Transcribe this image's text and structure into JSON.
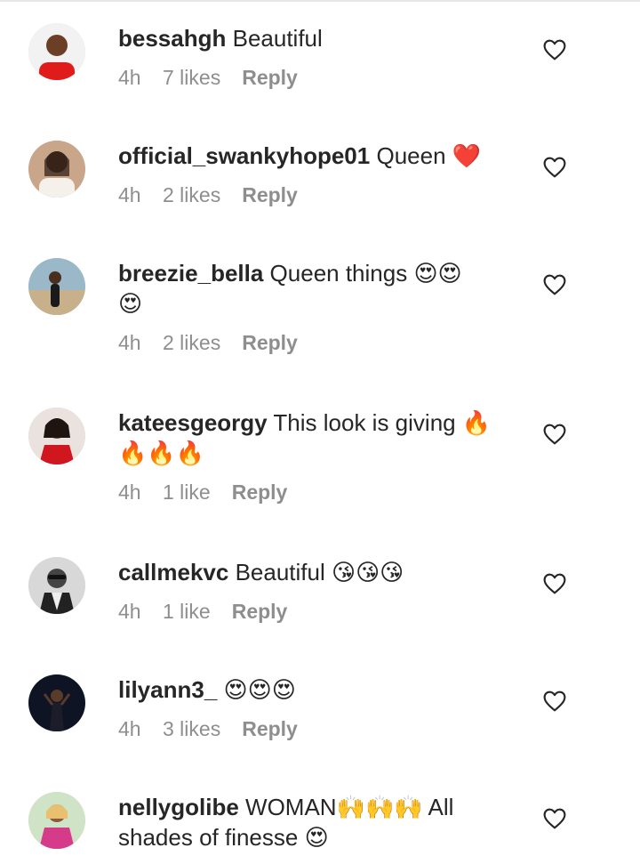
{
  "colors": {
    "text": "#262626",
    "muted": "#8e8e8e",
    "heart_red": "#e0245e"
  },
  "comments": [
    {
      "username": "bessahgh",
      "text": "Beautiful",
      "text_line2": "",
      "time": "4h",
      "likes": "7 likes",
      "reply": "Reply",
      "avatar": "avatar-red-shirt-man"
    },
    {
      "username": "official_swankyhope01",
      "text": "Queen ❤️",
      "text_line2": "",
      "time": "4h",
      "likes": "2 likes",
      "reply": "Reply",
      "avatar": "avatar-woman-white-top"
    },
    {
      "username": "breezie_bella",
      "text": "Queen things 😍😍",
      "text_line2": "😍",
      "time": "4h",
      "likes": "2 likes",
      "reply": "Reply",
      "avatar": "avatar-woman-outdoor"
    },
    {
      "username": "kateesgeorgy",
      "text": "This look is giving 🔥",
      "text_line2": "🔥🔥🔥",
      "time": "4h",
      "likes": "1 like",
      "reply": "Reply",
      "avatar": "avatar-woman-red-dress"
    },
    {
      "username": "callmekvc",
      "text": "Beautiful 😘😘😘",
      "text_line2": "",
      "time": "4h",
      "likes": "1 like",
      "reply": "Reply",
      "avatar": "avatar-grayscale-man"
    },
    {
      "username": "lilyann3_",
      "text": "😍😍😍",
      "text_line2": "",
      "time": "4h",
      "likes": "3 likes",
      "reply": "Reply",
      "avatar": "avatar-woman-dark-stage"
    },
    {
      "username": "nellygolibe",
      "text": "WOMAN🙌🙌🙌 All",
      "text_line2": "shades of finesse 😍",
      "time": "",
      "likes": "",
      "reply": "",
      "avatar": "avatar-woman-pink-outfit"
    }
  ]
}
